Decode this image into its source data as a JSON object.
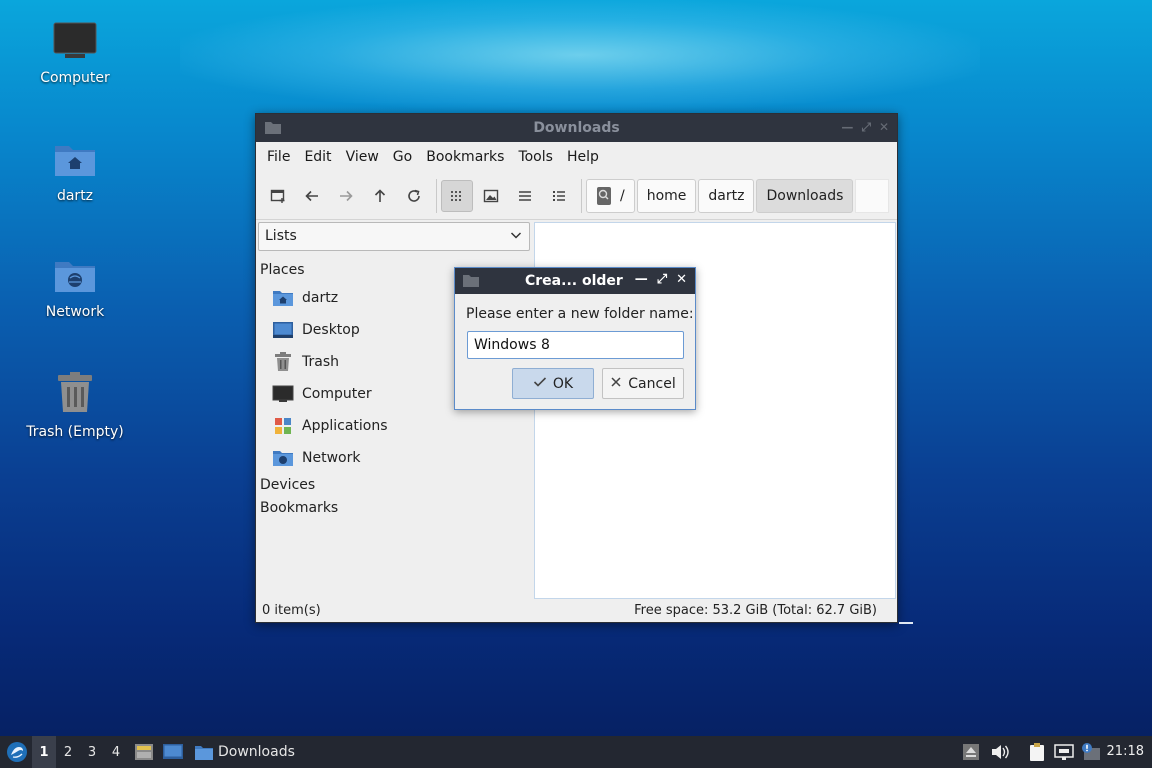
{
  "desktop": {
    "icons": [
      {
        "label": "Computer"
      },
      {
        "label": "dartz"
      },
      {
        "label": "Network"
      },
      {
        "label": "Trash (Empty)"
      }
    ]
  },
  "window": {
    "title": "Downloads",
    "menu": [
      "File",
      "Edit",
      "View",
      "Go",
      "Bookmarks",
      "Tools",
      "Help"
    ],
    "path": {
      "root": "/",
      "segments": [
        "home",
        "dartz",
        "Downloads"
      ]
    },
    "sidebar": {
      "select_value": "Lists",
      "sections": {
        "places": "Places",
        "devices": "Devices",
        "bookmarks": "Bookmarks"
      },
      "places": [
        {
          "label": "dartz",
          "icon": "home-folder-icon"
        },
        {
          "label": "Desktop",
          "icon": "desktop-icon"
        },
        {
          "label": "Trash",
          "icon": "trash-icon"
        },
        {
          "label": "Computer",
          "icon": "computer-icon"
        },
        {
          "label": "Applications",
          "icon": "applications-icon"
        },
        {
          "label": "Network",
          "icon": "network-icon"
        }
      ]
    },
    "status": {
      "items": "0 item(s)",
      "space": "Free space: 53.2 GiB (Total: 62.7 GiB)"
    }
  },
  "dialog": {
    "title": "Crea... older",
    "prompt": "Please enter a new folder name:",
    "input_value": "Windows 8",
    "ok_label": "OK",
    "cancel_label": "Cancel"
  },
  "taskbar": {
    "workspaces": [
      "1",
      "2",
      "3",
      "4"
    ],
    "active_workspace": "1",
    "task_label": "Downloads",
    "clock": "21:18"
  },
  "colors": {
    "titlebar": "#2f343f",
    "accent": "#5b8bc9",
    "folder_blue": "#4a86c8",
    "taskbar": "#232731"
  }
}
